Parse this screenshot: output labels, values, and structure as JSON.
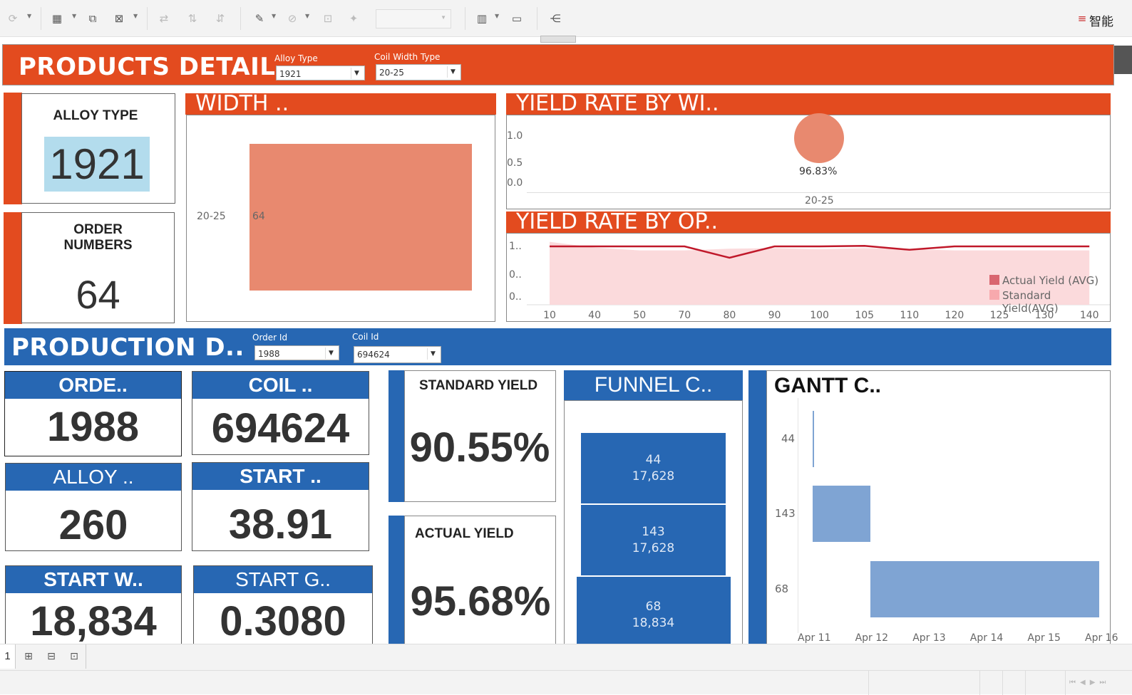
{
  "toolbar": {
    "brand": "智能"
  },
  "products": {
    "title": "PRODUCTS DETAIL",
    "filters": [
      {
        "label": "Alloy Type",
        "value": "1921"
      },
      {
        "label": "Coil Width Type",
        "value": "20-25"
      }
    ],
    "alloy": {
      "label": "ALLOY TYPE",
      "value": "1921"
    },
    "orders": {
      "label1": "ORDER",
      "label2": "NUMBERS",
      "value": "64"
    },
    "width": {
      "title": "WIDTH ..",
      "category": "20-25",
      "value_label": "64"
    },
    "yield_width": {
      "title": "YIELD RATE BY WI..",
      "ticks": [
        "1.0",
        "0.5",
        "0.0"
      ],
      "point_label": "96.83%",
      "category": "20-25"
    },
    "yield_op": {
      "title": "YIELD RATE BY OP..",
      "ticks": [
        "1..",
        "0..",
        "0.."
      ],
      "legend": [
        "Actual Yield (AVG)",
        "Standard Yield(AVG)"
      ]
    }
  },
  "production": {
    "title": "PRODUCTION D..",
    "filters": [
      {
        "label": "Order Id",
        "value": "1988"
      },
      {
        "label": "Coil Id",
        "value": "694624"
      }
    ],
    "kpis": {
      "order": {
        "label": "ORDE..",
        "value": "1988"
      },
      "coil": {
        "label": "COIL ..",
        "value": "694624"
      },
      "alloy": {
        "label": "ALLOY ..",
        "value": "260"
      },
      "start": {
        "label": "START ..",
        "value": "38.91"
      },
      "start_w": {
        "label": "START W..",
        "value": "18,834"
      },
      "start_g": {
        "label": "START G..",
        "value": "0.3080"
      }
    },
    "std_yield": {
      "label": "STANDARD YIELD",
      "value": "90.55%"
    },
    "act_yield": {
      "label": "ACTUAL YIELD",
      "value": "95.68%"
    },
    "funnel": {
      "title": "FUNNEL C..",
      "items": [
        {
          "id": "44",
          "val": "17,628"
        },
        {
          "id": "143",
          "val": "17,628"
        },
        {
          "id": "68",
          "val": "18,834"
        }
      ]
    },
    "gantt": {
      "title": "GANTT C..",
      "rows": [
        "44",
        "143",
        "68"
      ],
      "dates": [
        "Apr 11",
        "Apr 12",
        "Apr 13",
        "Apr 14",
        "Apr 15",
        "Apr 16"
      ]
    }
  },
  "sheet_tab": "1",
  "colors": {
    "orange": "#e34b1f",
    "blue": "#2767b3",
    "salmon": "#e8896f",
    "gantt_bar": "#7fa4d3",
    "actual_line": "#c0182a",
    "standard_area": "#fbdadc"
  },
  "chart_data": [
    {
      "type": "bar",
      "title": "WIDTH ..",
      "categories": [
        "20-25"
      ],
      "values": [
        64
      ]
    },
    {
      "type": "scatter",
      "title": "YIELD RATE BY WI..",
      "categories": [
        "20-25"
      ],
      "values": [
        0.9683
      ],
      "ylim": [
        0,
        1
      ]
    },
    {
      "type": "line",
      "title": "YIELD RATE BY OP..",
      "x": [
        "10",
        "40",
        "50",
        "70",
        "80",
        "90",
        "100",
        "105",
        "110",
        "120",
        "125",
        "130",
        "140"
      ],
      "series": [
        {
          "name": "Actual Yield (AVG)",
          "values": [
            1.0,
            1.0,
            1.0,
            1.0,
            0.8,
            1.0,
            1.0,
            1.01,
            0.94,
            1.0,
            1.0,
            1.0,
            1.0
          ]
        },
        {
          "name": "Standard Yield(AVG)",
          "values": [
            1.08,
            0.98,
            0.93,
            0.93,
            0.96,
            0.97,
            0.95,
            0.97,
            0.95,
            0.93,
            0.93,
            0.93,
            0.93
          ]
        }
      ]
    },
    {
      "type": "bar",
      "title": "FUNNEL C..",
      "categories": [
        "44",
        "143",
        "68"
      ],
      "values": [
        17628,
        17628,
        18834
      ]
    },
    {
      "type": "bar",
      "title": "GANTT C..",
      "categories": [
        "44",
        "143",
        "68"
      ],
      "starts": [
        "Apr 11",
        "Apr 11",
        "Apr 12"
      ],
      "ends": [
        "Apr 11",
        "Apr 12",
        "Apr 16"
      ]
    }
  ]
}
